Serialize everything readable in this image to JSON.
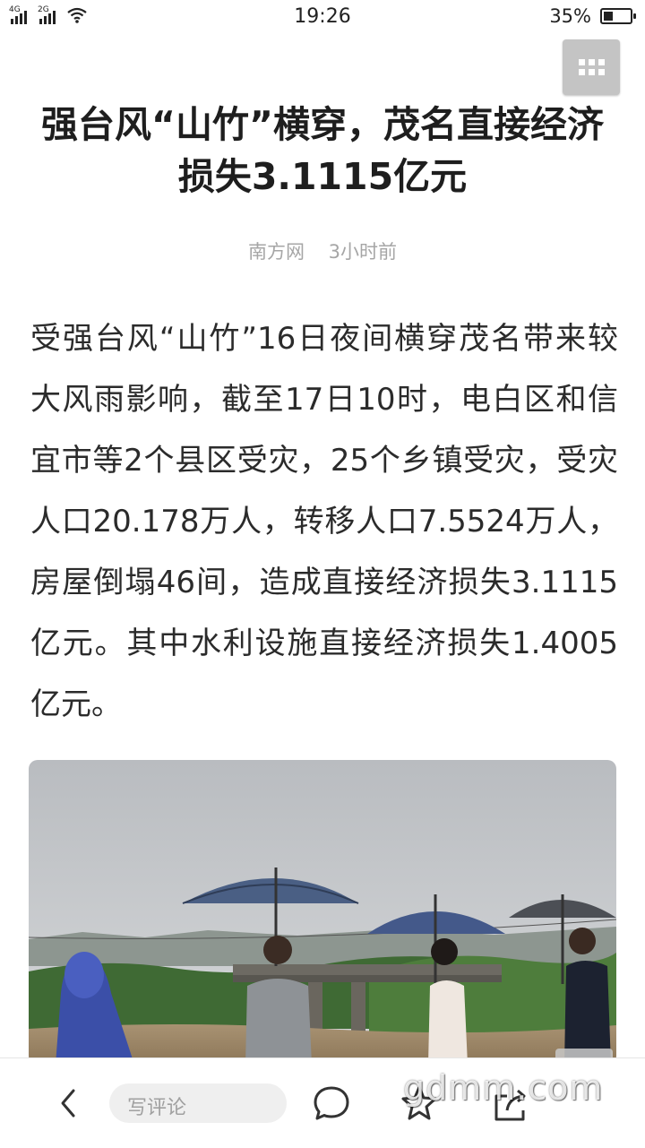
{
  "status_bar": {
    "network_1": "4G",
    "network_2": "2G",
    "time": "19:26",
    "battery_text": "35%",
    "battery_level": 0.35
  },
  "article": {
    "title": "强台风“山竹”横穿，茂名直接经济损失3.1115亿元",
    "source": "南方网",
    "time_ago": "3小时前",
    "body": "受强台风“山竹”16日夜间横穿茂名带来较大风雨影响，截至17日10时，电白区和信宜市等2个县区受灾，25个乡镇受灾，受灾人口20.178万人，转移人口7.5524万人，房屋倒塌46间，造成直接经济损失3.1115亿元。其中水利设施直接经济损失1.4005亿元。"
  },
  "bottom_bar": {
    "comment_placeholder": "写评论"
  },
  "watermark": "gdmm.com",
  "icons": {
    "menu": "grid-icon",
    "back": "chevron-left-icon",
    "comments": "chat-bubble-icon",
    "favorite": "star-icon",
    "share": "share-icon",
    "download": "download-arrow-icon"
  }
}
